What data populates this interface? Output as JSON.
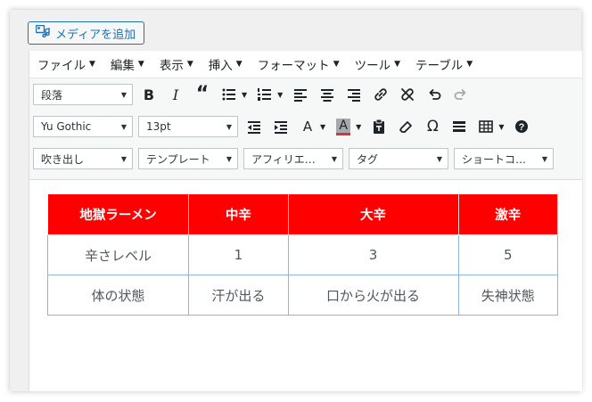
{
  "add_media": {
    "label": "メディアを追加",
    "icon": "media-icon"
  },
  "menubar": [
    {
      "label": "ファイル"
    },
    {
      "label": "編集"
    },
    {
      "label": "表示"
    },
    {
      "label": "挿入"
    },
    {
      "label": "フォーマット"
    },
    {
      "label": "ツール"
    },
    {
      "label": "テーブル"
    }
  ],
  "toolbar": {
    "format_select": "段落",
    "font_family": "Yu Gothic",
    "font_size": "13pt",
    "row3": [
      "吹き出し",
      "テンプレート",
      "アフィリエ…",
      "タグ",
      "ショートコ…"
    ],
    "text_color_accent": "#d63638"
  },
  "table": {
    "header": [
      "地獄ラーメン",
      "中辛",
      "大辛",
      "激辛"
    ],
    "rows": [
      [
        "辛さレベル",
        "1",
        "3",
        "5"
      ],
      [
        "体の状態",
        "汗が出る",
        "口から火が出る",
        "失神状態"
      ]
    ],
    "header_color": "#ff0000"
  }
}
